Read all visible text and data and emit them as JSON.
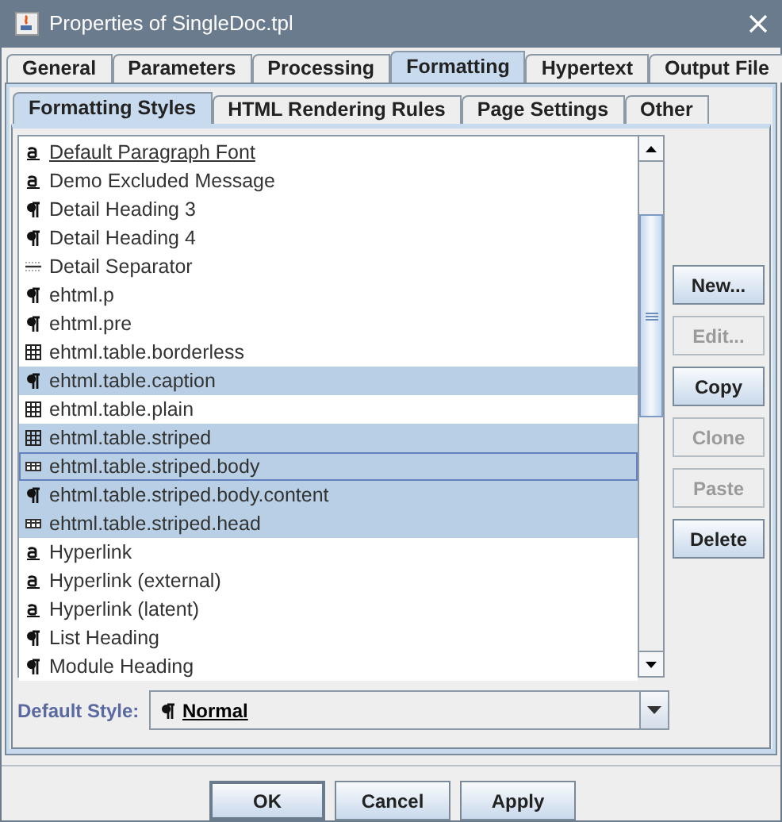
{
  "window": {
    "title": "Properties of SingleDoc.tpl"
  },
  "tabs": [
    {
      "label": "General",
      "selected": false
    },
    {
      "label": "Parameters",
      "selected": false
    },
    {
      "label": "Processing",
      "selected": false
    },
    {
      "label": "Formatting",
      "selected": true
    },
    {
      "label": "Hypertext",
      "selected": false
    },
    {
      "label": "Output File",
      "selected": false
    }
  ],
  "subtabs": [
    {
      "label": "Formatting Styles",
      "selected": true
    },
    {
      "label": "HTML Rendering Rules",
      "selected": false
    },
    {
      "label": "Page Settings",
      "selected": false
    },
    {
      "label": "Other",
      "selected": false
    }
  ],
  "styles": [
    {
      "name": "Default Paragraph Font",
      "kind": "character",
      "underlined": true,
      "selected": false,
      "focused": false
    },
    {
      "name": "Demo Excluded Message",
      "kind": "character",
      "underlined": false,
      "selected": false,
      "focused": false
    },
    {
      "name": "Detail Heading 3",
      "kind": "paragraph",
      "underlined": false,
      "selected": false,
      "focused": false
    },
    {
      "name": "Detail Heading 4",
      "kind": "paragraph",
      "underlined": false,
      "selected": false,
      "focused": false
    },
    {
      "name": "Detail Separator",
      "kind": "separator",
      "underlined": false,
      "selected": false,
      "focused": false
    },
    {
      "name": "ehtml.p",
      "kind": "paragraph",
      "underlined": false,
      "selected": false,
      "focused": false
    },
    {
      "name": "ehtml.pre",
      "kind": "paragraph",
      "underlined": false,
      "selected": false,
      "focused": false
    },
    {
      "name": "ehtml.table.borderless",
      "kind": "table",
      "underlined": false,
      "selected": false,
      "focused": false
    },
    {
      "name": "ehtml.table.caption",
      "kind": "paragraph",
      "underlined": false,
      "selected": true,
      "focused": false
    },
    {
      "name": "ehtml.table.plain",
      "kind": "table",
      "underlined": false,
      "selected": false,
      "focused": false
    },
    {
      "name": "ehtml.table.striped",
      "kind": "table",
      "underlined": false,
      "selected": true,
      "focused": false
    },
    {
      "name": "ehtml.table.striped.body",
      "kind": "row",
      "underlined": false,
      "selected": true,
      "focused": true
    },
    {
      "name": "ehtml.table.striped.body.content",
      "kind": "paragraph",
      "underlined": false,
      "selected": true,
      "focused": false
    },
    {
      "name": "ehtml.table.striped.head",
      "kind": "row",
      "underlined": false,
      "selected": true,
      "focused": false
    },
    {
      "name": "Hyperlink",
      "kind": "character",
      "underlined": false,
      "selected": false,
      "focused": false
    },
    {
      "name": "Hyperlink (external)",
      "kind": "character",
      "underlined": false,
      "selected": false,
      "focused": false
    },
    {
      "name": "Hyperlink (latent)",
      "kind": "character",
      "underlined": false,
      "selected": false,
      "focused": false
    },
    {
      "name": "List Heading",
      "kind": "paragraph",
      "underlined": false,
      "selected": false,
      "focused": false
    },
    {
      "name": "Module Heading",
      "kind": "paragraph",
      "underlined": false,
      "selected": false,
      "focused": false
    }
  ],
  "side_buttons": [
    {
      "label": "New...",
      "disabled": false
    },
    {
      "label": "Edit...",
      "disabled": true
    },
    {
      "label": "Copy",
      "disabled": false
    },
    {
      "label": "Clone",
      "disabled": true
    },
    {
      "label": "Paste",
      "disabled": true
    },
    {
      "label": "Delete",
      "disabled": false
    }
  ],
  "default_style": {
    "label": "Default Style:",
    "value": "Normal",
    "kind": "paragraph"
  },
  "buttons": [
    {
      "label": "OK",
      "default": true
    },
    {
      "label": "Cancel",
      "default": false
    },
    {
      "label": "Apply",
      "default": false
    }
  ]
}
